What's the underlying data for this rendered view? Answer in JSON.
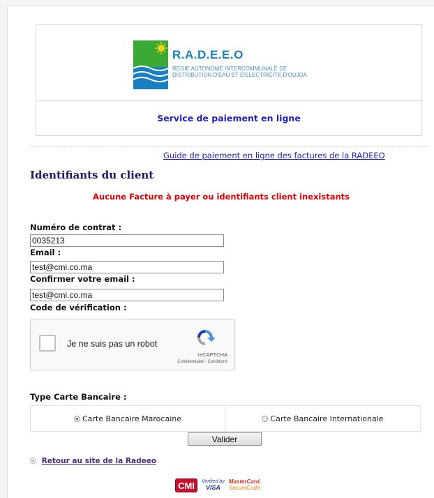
{
  "header": {
    "logo_title": "R.A.D.E.E.O",
    "logo_subtitle": "REGIE AUTONOME INTERCOMMUNALE DE DISTRIBUTION D'EAU ET D'ELECTRICITE D'OUJDA",
    "service_title": "Service de paiement en ligne"
  },
  "guide_link": "Guide de paiement en ligne des factures de la RADEEO",
  "section_title": "Identifiants du client",
  "error_message": "Aucune Facture à payer ou identifiants client inexistants",
  "form": {
    "contract_label": "Numéro de contrat :",
    "contract_value": "0035213",
    "email_label": "Email :",
    "email_value": "test@cmi.co.ma",
    "confirm_email_label": "Confirmer votre email :",
    "confirm_email_value": "test@cmi.co.ma",
    "verification_label": "Code de vérification :"
  },
  "recaptcha": {
    "checkbox_text": "Je ne suis pas un robot",
    "brand": "reCAPTCHA",
    "links": "Confidentialité - Conditions"
  },
  "card_type": {
    "label": "Type Carte Bancaire :",
    "options": [
      {
        "label": "Carte Bancaire Marocaine",
        "checked": true
      },
      {
        "label": "Carte Bancaire Internationale",
        "checked": false
      }
    ]
  },
  "submit_label": "Valider",
  "back_link": "Retour au site de la Radeeo",
  "payment_logos": {
    "cmi": "CMI",
    "visa_top": "Verified by",
    "visa_bottom": "VISA",
    "mastercard_top": "MasterCard.",
    "mastercard_bottom": "SecureCode."
  },
  "colors": {
    "link_blue": "#1f1fbf",
    "error_red": "#e00000",
    "title_navy": "#1a1a66",
    "logo_blue": "#1a7fc1",
    "logo_green": "#3aaa35"
  }
}
